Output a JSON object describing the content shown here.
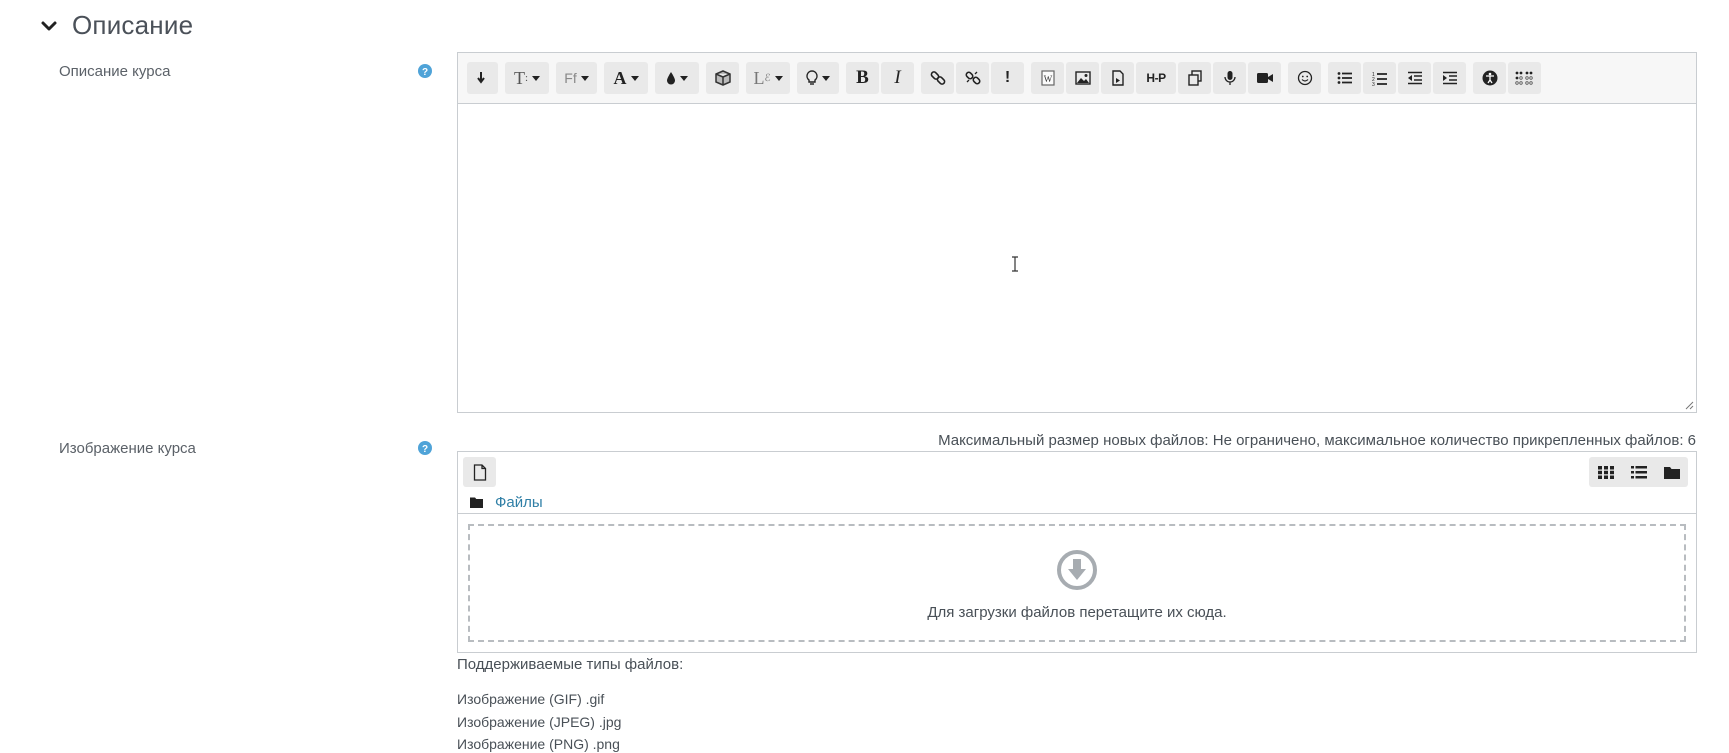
{
  "section": {
    "title": "Описание"
  },
  "course_description": {
    "label": "Описание курса"
  },
  "toolbar": {
    "icons": [
      "insert-icon",
      "text-style-icon",
      "font-icon",
      "font-color-icon",
      "background-color-icon",
      "cube-icon",
      "equation-icon",
      "lightbulb-icon",
      "bold-icon",
      "italic-icon",
      "link-icon",
      "unlink-icon",
      "exclamation-icon",
      "word-import-icon",
      "image-icon",
      "media-icon",
      "h5p-icon",
      "copy-icon",
      "microphone-icon",
      "video-icon",
      "emoji-icon",
      "bullet-list-icon",
      "numbered-list-icon",
      "outdent-icon",
      "indent-icon",
      "accessibility-icon",
      "braille-icon"
    ],
    "labels": {
      "bold": "B",
      "italic": "I",
      "exclaim": "!",
      "font": "Ff",
      "textcolor": "A",
      "h5p": "H-P"
    }
  },
  "course_image": {
    "label": "Изображение курса",
    "limits": "Максимальный размер новых файлов: Не ограничено, максимальное количество прикрепленных файлов: 6",
    "path_link": "Файлы",
    "drop_text": "Для загрузки файлов перетащите их сюда.",
    "types_title": "Поддерживаемые типы файлов:",
    "types": [
      "Изображение (GIF) .gif",
      "Изображение (JPEG) .jpg",
      "Изображение (PNG) .png"
    ]
  },
  "colors": {
    "help": "#4fa3d8",
    "link": "#2f7fa6",
    "border": "#c9cdd1"
  }
}
